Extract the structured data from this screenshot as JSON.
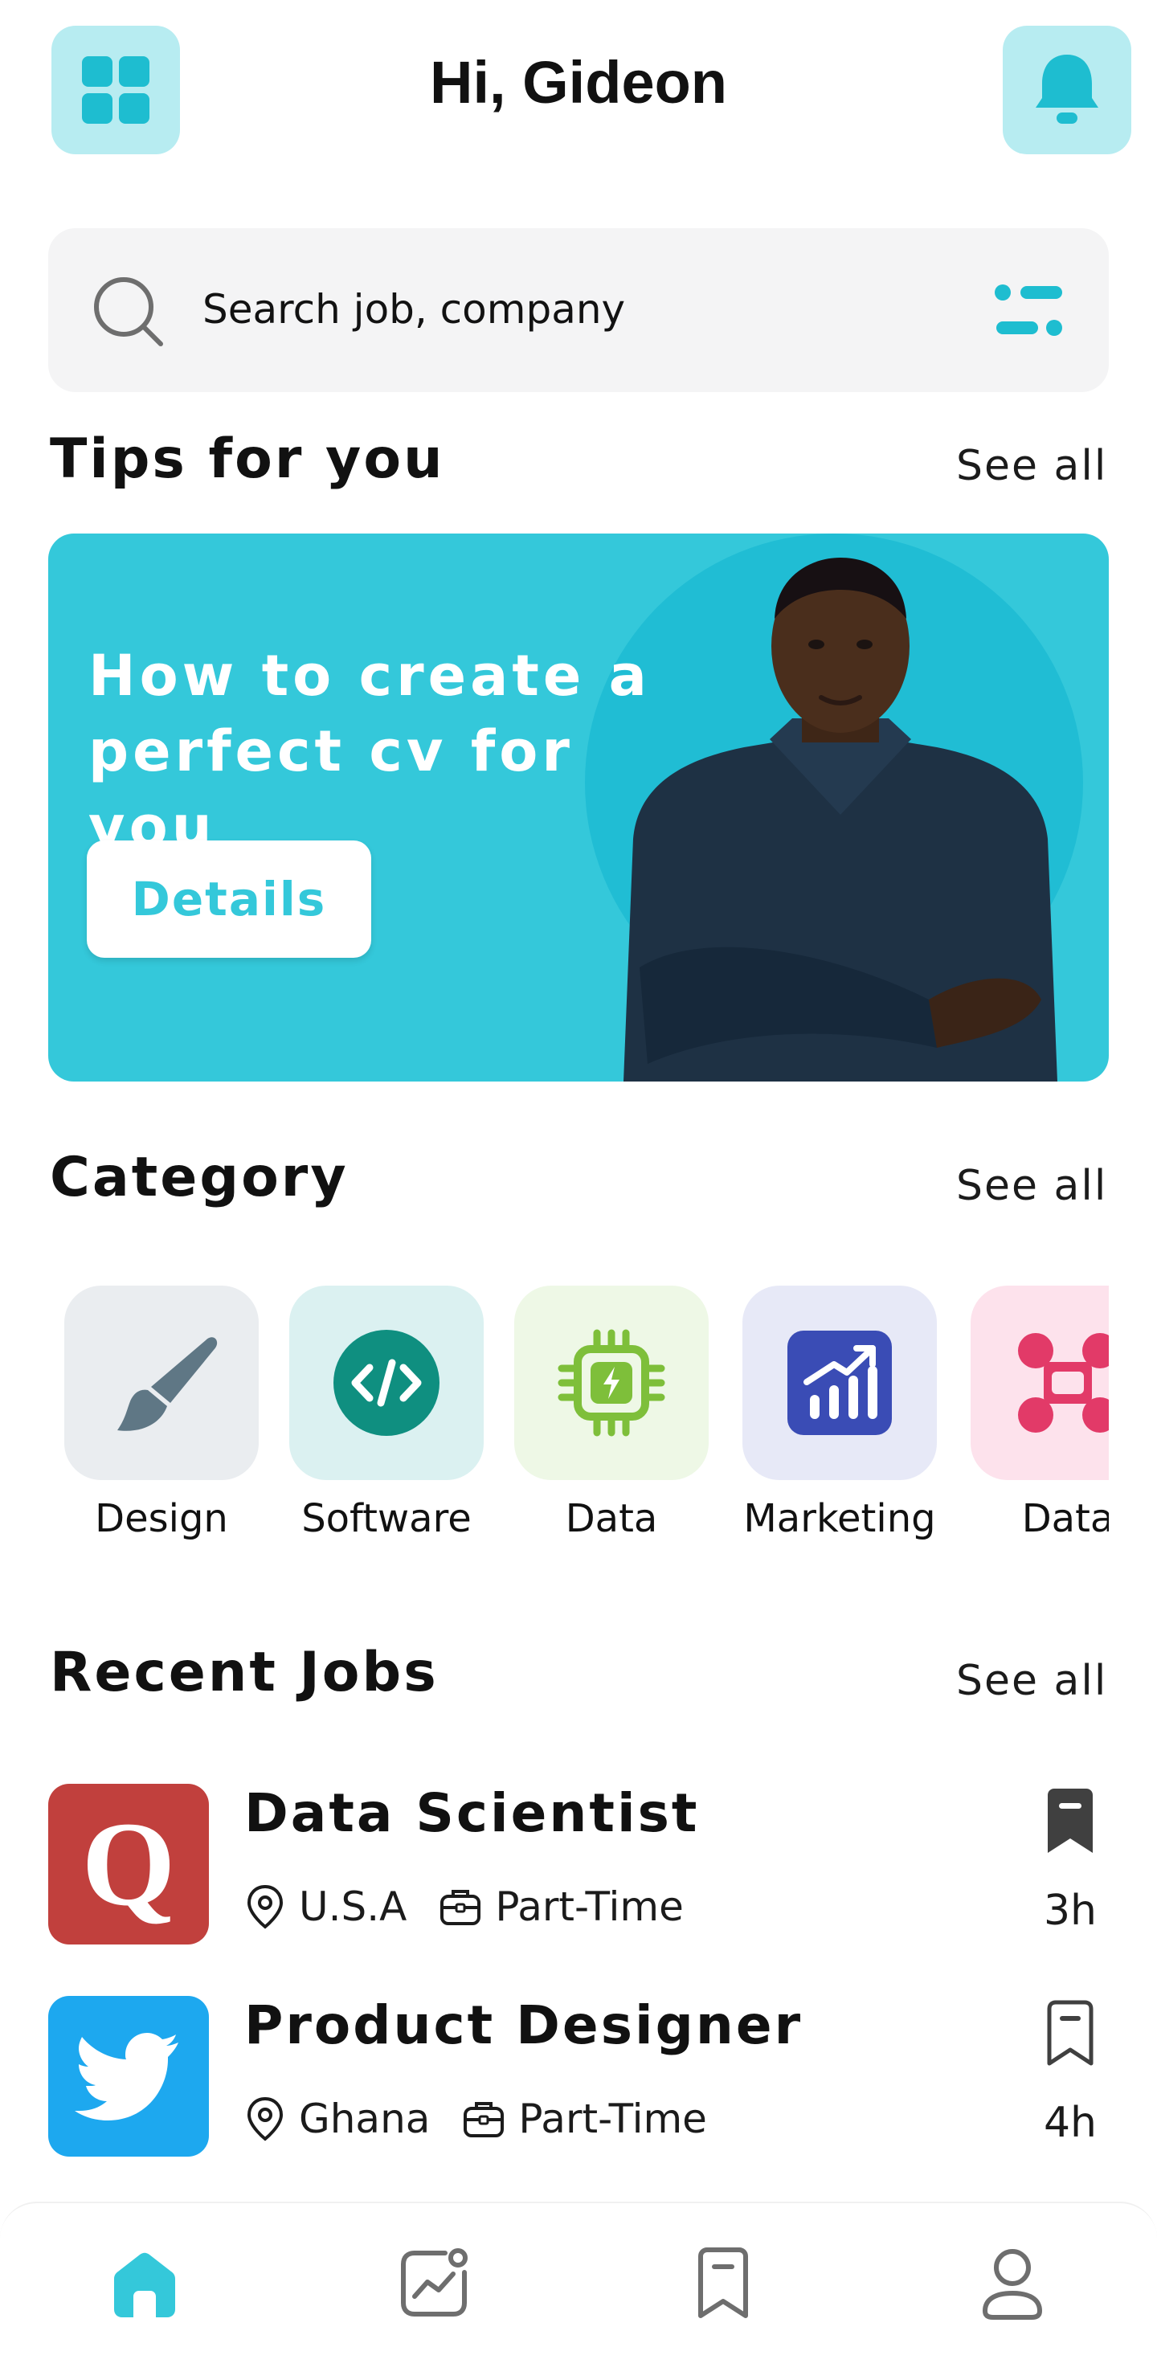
{
  "header": {
    "greeting": "Hi, Gideon",
    "menu_icon": "grid-icon",
    "notification_icon": "bell-icon"
  },
  "search": {
    "placeholder": "Search job, company",
    "search_icon": "search-icon",
    "filter_icon": "filter-icon"
  },
  "tips": {
    "title": "Tips for you",
    "see_all": "See all",
    "banner": {
      "headline_line1": "How to create a",
      "headline_line2": "perfect cv for you",
      "button_label": "Details"
    }
  },
  "category": {
    "title": "Category",
    "see_all": "See all",
    "items": [
      {
        "label": "Design",
        "icon": "paintbrush-icon",
        "bg": "#eaedf0",
        "color": "#5f7785"
      },
      {
        "label": "Software",
        "icon": "code-icon",
        "bg": "#dbf1f1",
        "color": "#0f8f80"
      },
      {
        "label": "Data",
        "icon": "chip-icon",
        "bg": "#eef8e6",
        "color": "#7ebf3a"
      },
      {
        "label": "Marketing",
        "icon": "chart-icon",
        "bg": "#e7e9f7",
        "color": "#3a4cb5"
      },
      {
        "label": "Data",
        "icon": "network-icon",
        "bg": "#fde2ec",
        "color": "#e23a68"
      }
    ]
  },
  "recent_jobs": {
    "title": "Recent Jobs",
    "see_all": "See all",
    "items": [
      {
        "title": "Data Scientist",
        "location": "U.S.A",
        "type": "Part-Time",
        "time": "3h",
        "saved": true,
        "logo_letter": "Q",
        "logo_bg": "#c1403d"
      },
      {
        "title": "Product Designer",
        "location": "Ghana",
        "type": "Part-Time",
        "time": "4h",
        "saved": false,
        "logo_icon": "twitter-bird-icon",
        "logo_bg": "#1da8ef"
      }
    ]
  },
  "nav": {
    "items": [
      {
        "icon": "home-icon",
        "active": true
      },
      {
        "icon": "analytics-icon",
        "active": false
      },
      {
        "icon": "bookmark-icon",
        "active": false
      },
      {
        "icon": "profile-icon",
        "active": false
      }
    ]
  },
  "colors": {
    "accent": "#34c8da",
    "accent_light": "#b7ecf1",
    "text": "#121212"
  }
}
